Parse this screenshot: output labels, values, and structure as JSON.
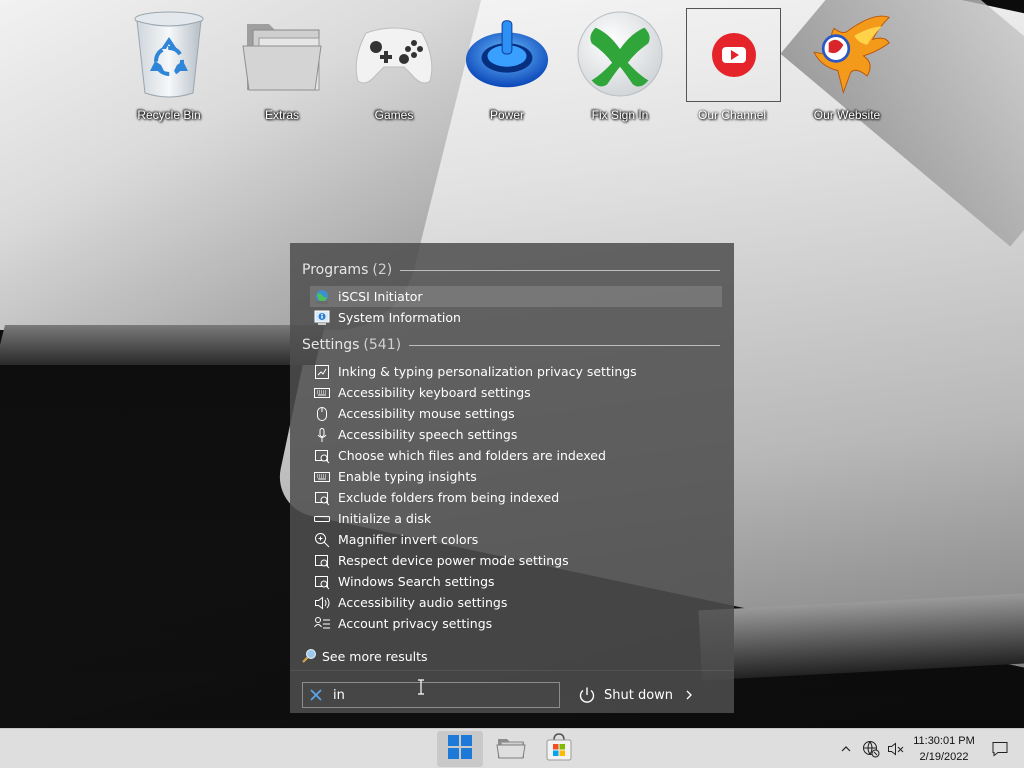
{
  "desktop": {
    "icons": [
      {
        "label": "Recycle Bin",
        "icon": "recycle-bin-icon"
      },
      {
        "label": "Extras",
        "icon": "folder-stack-icon"
      },
      {
        "label": "Games",
        "icon": "gamepad-icon"
      },
      {
        "label": "Power",
        "icon": "power-icon"
      },
      {
        "label": "Fix Sign In",
        "icon": "xbox-icon"
      },
      {
        "label": "Our Channel",
        "icon": "youtube-icon"
      },
      {
        "label": "Our Website",
        "icon": "phoenix-logo-icon"
      }
    ]
  },
  "search": {
    "programs": {
      "title": "Programs",
      "count": "(2)",
      "items": [
        {
          "label": "iSCSI Initiator",
          "icon": "globe-network-icon"
        },
        {
          "label": "System Information",
          "icon": "system-info-icon"
        }
      ]
    },
    "settings": {
      "title": "Settings",
      "count": "(541)",
      "items": [
        {
          "label": "Inking & typing personalization privacy settings",
          "icon": "inking-icon"
        },
        {
          "label": "Accessibility keyboard settings",
          "icon": "keyboard-icon"
        },
        {
          "label": "Accessibility mouse settings",
          "icon": "mouse-icon"
        },
        {
          "label": "Accessibility speech settings",
          "icon": "microphone-icon"
        },
        {
          "label": "Choose which files and folders are indexed",
          "icon": "search-index-icon"
        },
        {
          "label": "Enable typing insights",
          "icon": "keyboard-icon"
        },
        {
          "label": "Exclude folders from being indexed",
          "icon": "search-index-icon"
        },
        {
          "label": "Initialize a disk",
          "icon": "disk-icon"
        },
        {
          "label": "Magnifier invert colors",
          "icon": "magnifier-icon"
        },
        {
          "label": "Respect device power mode settings",
          "icon": "search-index-icon"
        },
        {
          "label": "Windows Search settings",
          "icon": "search-index-icon"
        },
        {
          "label": "Accessibility audio settings",
          "icon": "speaker-icon"
        },
        {
          "label": "Account privacy settings",
          "icon": "account-list-icon"
        }
      ]
    },
    "see_more": "See more results",
    "query": "in",
    "shutdown_label": "Shut down"
  },
  "taskbar": {
    "time": "11:30:01 PM",
    "date": "2/19/2022"
  },
  "colors": {
    "accent_blue": "#1e7ad8",
    "xbox_green": "#2fa53a",
    "youtube_red": "#e4232b"
  }
}
